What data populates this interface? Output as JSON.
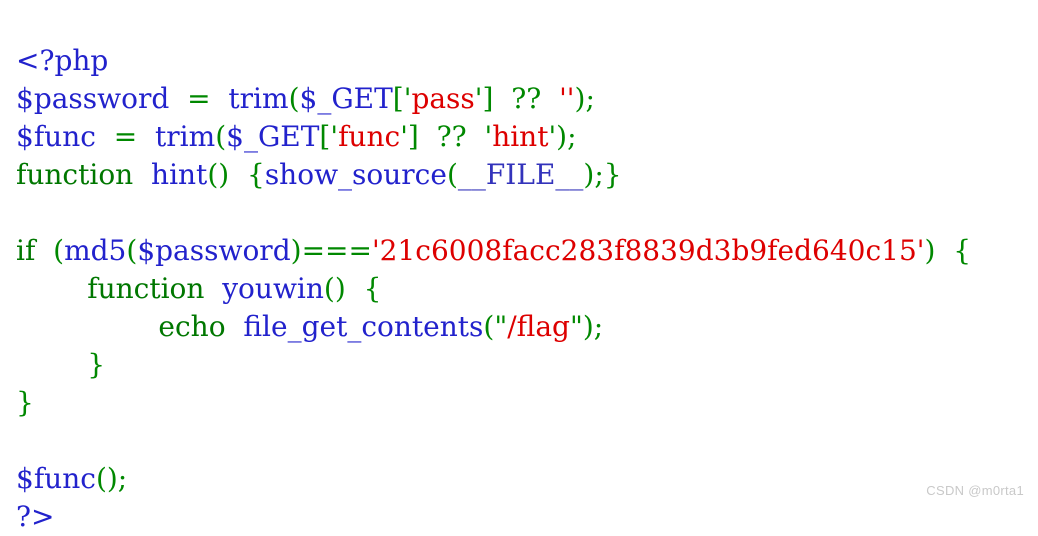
{
  "document": {
    "language": "PHP",
    "background_color": "#ffffff",
    "colors": {
      "tag": "#2222cc",
      "variable": "#2222cc",
      "function": "#2222cc",
      "constant": "#3333bb",
      "keyword": "#007700",
      "punctuation": "#008800",
      "operator": "#008800",
      "string": "#dd0000",
      "watermark": "#c9c9c9"
    }
  },
  "code": {
    "lines": [
      {
        "index": 1,
        "text": "<?php",
        "tokens": [
          {
            "t": "<?php",
            "c": "tok-tag"
          }
        ]
      },
      {
        "index": 2,
        "text": "$password  =  trim($_GET['pass']  ??  '');",
        "tokens": [
          {
            "t": "$password",
            "c": "tok-var"
          },
          {
            "t": "  ",
            "c": "tok-plain"
          },
          {
            "t": "=",
            "c": "tok-op"
          },
          {
            "t": "  ",
            "c": "tok-plain"
          },
          {
            "t": "trim",
            "c": "tok-func"
          },
          {
            "t": "(",
            "c": "tok-punct"
          },
          {
            "t": "$_GET",
            "c": "tok-var"
          },
          {
            "t": "[",
            "c": "tok-punct"
          },
          {
            "t": "'",
            "c": "tok-quote-g"
          },
          {
            "t": "pass",
            "c": "tok-string"
          },
          {
            "t": "'",
            "c": "tok-quote-g"
          },
          {
            "t": "]",
            "c": "tok-punct"
          },
          {
            "t": "  ",
            "c": "tok-plain"
          },
          {
            "t": "??",
            "c": "tok-op"
          },
          {
            "t": "  ",
            "c": "tok-plain"
          },
          {
            "t": "''",
            "c": "tok-quote-r"
          },
          {
            "t": ")",
            "c": "tok-punct"
          },
          {
            "t": ";",
            "c": "tok-punct"
          }
        ]
      },
      {
        "index": 3,
        "text": "$func  =  trim($_GET['func']  ??  'hint');",
        "tokens": [
          {
            "t": "$func",
            "c": "tok-var"
          },
          {
            "t": "  ",
            "c": "tok-plain"
          },
          {
            "t": "=",
            "c": "tok-op"
          },
          {
            "t": "  ",
            "c": "tok-plain"
          },
          {
            "t": "trim",
            "c": "tok-func"
          },
          {
            "t": "(",
            "c": "tok-punct"
          },
          {
            "t": "$_GET",
            "c": "tok-var"
          },
          {
            "t": "[",
            "c": "tok-punct"
          },
          {
            "t": "'",
            "c": "tok-quote-g"
          },
          {
            "t": "func",
            "c": "tok-string"
          },
          {
            "t": "'",
            "c": "tok-quote-g"
          },
          {
            "t": "]",
            "c": "tok-punct"
          },
          {
            "t": "  ",
            "c": "tok-plain"
          },
          {
            "t": "??",
            "c": "tok-op"
          },
          {
            "t": "  ",
            "c": "tok-plain"
          },
          {
            "t": "'",
            "c": "tok-quote-g"
          },
          {
            "t": "hint",
            "c": "tok-string"
          },
          {
            "t": "'",
            "c": "tok-quote-g"
          },
          {
            "t": ")",
            "c": "tok-punct"
          },
          {
            "t": ";",
            "c": "tok-punct"
          }
        ]
      },
      {
        "index": 4,
        "text": "function  hint()  {show_source(__FILE__);}",
        "tokens": [
          {
            "t": "function",
            "c": "tok-keyword"
          },
          {
            "t": "  ",
            "c": "tok-plain"
          },
          {
            "t": "hint",
            "c": "tok-func"
          },
          {
            "t": "()",
            "c": "tok-punct"
          },
          {
            "t": "  ",
            "c": "tok-plain"
          },
          {
            "t": "{",
            "c": "tok-punct"
          },
          {
            "t": "show_source",
            "c": "tok-func"
          },
          {
            "t": "(",
            "c": "tok-punct"
          },
          {
            "t": "__FILE__",
            "c": "tok-const"
          },
          {
            "t": ")",
            "c": "tok-punct"
          },
          {
            "t": ";",
            "c": "tok-punct"
          },
          {
            "t": "}",
            "c": "tok-punct"
          }
        ]
      },
      {
        "index": 5,
        "text": "",
        "tokens": []
      },
      {
        "index": 6,
        "text": "if  (md5($password)==='21c6008facc283f8839d3b9fed640c15')  {",
        "tokens": [
          {
            "t": "if",
            "c": "tok-keyword"
          },
          {
            "t": "  ",
            "c": "tok-plain"
          },
          {
            "t": "(",
            "c": "tok-punct"
          },
          {
            "t": "md5",
            "c": "tok-func"
          },
          {
            "t": "(",
            "c": "tok-punct"
          },
          {
            "t": "$password",
            "c": "tok-var"
          },
          {
            "t": ")",
            "c": "tok-punct"
          },
          {
            "t": "===",
            "c": "tok-op"
          },
          {
            "t": "'",
            "c": "tok-quote-r"
          },
          {
            "t": "21c6008facc283f8839d3b9fed640c15",
            "c": "tok-string"
          },
          {
            "t": "'",
            "c": "tok-quote-r"
          },
          {
            "t": ")",
            "c": "tok-punct"
          },
          {
            "t": "  ",
            "c": "tok-plain"
          },
          {
            "t": "{",
            "c": "tok-punct"
          }
        ]
      },
      {
        "index": 7,
        "text": "        function  youwin()  {",
        "tokens": [
          {
            "t": "        ",
            "c": "tok-plain"
          },
          {
            "t": "function",
            "c": "tok-keyword"
          },
          {
            "t": "  ",
            "c": "tok-plain"
          },
          {
            "t": "youwin",
            "c": "tok-func"
          },
          {
            "t": "()",
            "c": "tok-punct"
          },
          {
            "t": "  ",
            "c": "tok-plain"
          },
          {
            "t": "{",
            "c": "tok-punct"
          }
        ]
      },
      {
        "index": 8,
        "text": "                echo  file_get_contents(\"/flag\");",
        "tokens": [
          {
            "t": "                ",
            "c": "tok-plain"
          },
          {
            "t": "echo",
            "c": "tok-keyword"
          },
          {
            "t": "  ",
            "c": "tok-plain"
          },
          {
            "t": "file_get_contents",
            "c": "tok-func"
          },
          {
            "t": "(",
            "c": "tok-punct"
          },
          {
            "t": "\"",
            "c": "tok-quote-g"
          },
          {
            "t": "/flag",
            "c": "tok-string"
          },
          {
            "t": "\"",
            "c": "tok-quote-g"
          },
          {
            "t": ")",
            "c": "tok-punct"
          },
          {
            "t": ";",
            "c": "tok-punct"
          }
        ]
      },
      {
        "index": 9,
        "text": "        }",
        "tokens": [
          {
            "t": "        ",
            "c": "tok-plain"
          },
          {
            "t": "}",
            "c": "tok-punct"
          }
        ]
      },
      {
        "index": 10,
        "text": "}",
        "tokens": [
          {
            "t": "}",
            "c": "tok-punct"
          }
        ]
      },
      {
        "index": 11,
        "text": "",
        "tokens": []
      },
      {
        "index": 12,
        "text": "$func();",
        "tokens": [
          {
            "t": "$func",
            "c": "tok-var"
          },
          {
            "t": "()",
            "c": "tok-punct"
          },
          {
            "t": ";",
            "c": "tok-punct"
          }
        ]
      },
      {
        "index": 13,
        "text": "?>",
        "tokens": [
          {
            "t": "?>",
            "c": "tok-tag"
          }
        ]
      }
    ]
  },
  "watermark": {
    "text": "CSDN @m0rta1"
  }
}
